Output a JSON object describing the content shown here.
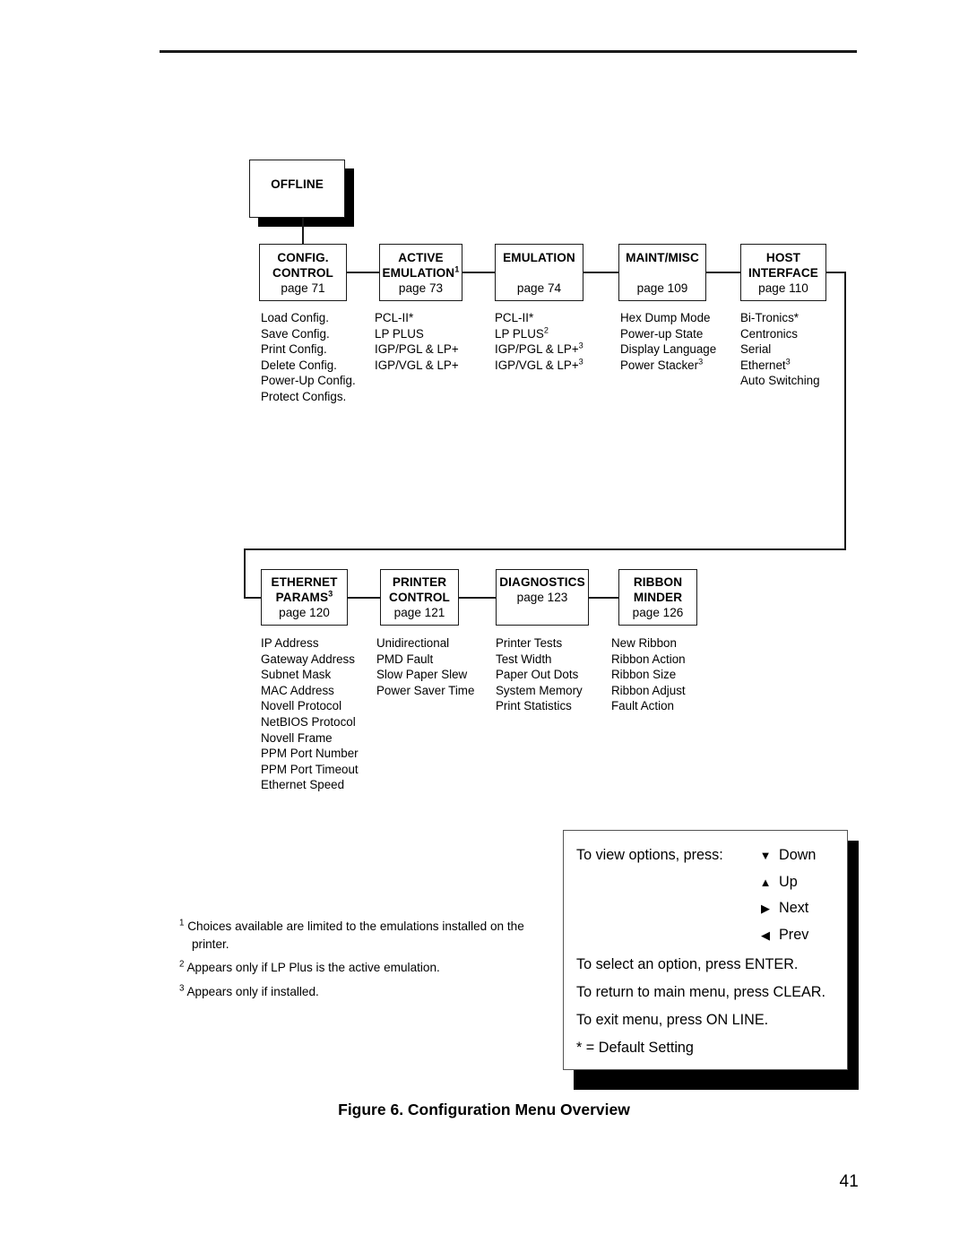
{
  "page": {
    "number": "41",
    "figure_caption": "Figure 6. Configuration Menu Overview"
  },
  "flowchart": {
    "root": {
      "title": "OFFLINE"
    },
    "row1": [
      {
        "name": "config-control",
        "title_line1": "CONFIG.",
        "title_line2": "CONTROL",
        "page": "page 71",
        "options": [
          "Load Config.",
          "Save Config.",
          "Print Config.",
          "Delete Config.",
          "Power-Up Config.",
          "Protect Configs."
        ]
      },
      {
        "name": "active-emulation",
        "title_line1": "ACTIVE",
        "title_line2": "EMULATION",
        "title_line2_sup": "1",
        "page": "page 73",
        "options": [
          "PCL-II*",
          "LP PLUS",
          "IGP/PGL & LP+",
          "IGP/VGL & LP+"
        ]
      },
      {
        "name": "emulation",
        "title_line1": "EMULATION",
        "page": "page 74",
        "options": [
          "PCL-II*",
          "LP PLUS",
          "IGP/PGL & LP+",
          "IGP/VGL & LP+"
        ],
        "option_sups": [
          "",
          "2",
          "3",
          "3"
        ]
      },
      {
        "name": "maint-misc",
        "title_line1": "MAINT/MISC",
        "page": "page 109",
        "options": [
          "Hex Dump Mode",
          "Power-up State",
          "Display Language",
          "Power Stacker"
        ],
        "option_sups": [
          "",
          "",
          "",
          "3"
        ]
      },
      {
        "name": "host-interface",
        "title_line1": "HOST",
        "title_line2": "INTERFACE",
        "page": "page 110",
        "options": [
          "Bi-Tronics*",
          "Centronics",
          "Serial",
          "Ethernet",
          "Auto Switching"
        ],
        "option_sups": [
          "",
          "",
          "",
          "3",
          ""
        ]
      }
    ],
    "row2": [
      {
        "name": "ethernet-params",
        "title_line1": "ETHERNET",
        "title_line2": "PARAMS",
        "title_line2_sup": "3",
        "page": "page 120",
        "options": [
          "IP Address",
          "Gateway Address",
          "Subnet Mask",
          "MAC Address",
          "Novell Protocol",
          "NetBIOS Protocol",
          "Novell Frame",
          "PPM Port Number",
          "PPM Port Timeout",
          "Ethernet Speed"
        ]
      },
      {
        "name": "printer-control",
        "title_line1": "PRINTER",
        "title_line2": "CONTROL",
        "page": "page 121",
        "options": [
          "Unidirectional",
          "PMD Fault",
          "Slow Paper Slew",
          "Power Saver Time"
        ]
      },
      {
        "name": "diagnostics",
        "title_line1": "DIAGNOSTICS",
        "page": "page 123",
        "options": [
          "Printer Tests",
          "Test Width",
          "Paper Out Dots",
          "System Memory",
          "Print Statistics"
        ]
      },
      {
        "name": "ribbon-minder",
        "title_line1": "RIBBON",
        "title_line2": "MINDER",
        "page": "page 126",
        "options": [
          "New Ribbon",
          "Ribbon Action",
          "Ribbon Size",
          "Ribbon Adjust",
          "Fault Action"
        ]
      }
    ]
  },
  "footnotes": [
    {
      "mark": "1",
      "text": "Choices available are limited to the emulations installed on the printer."
    },
    {
      "mark": "2",
      "text": "Appears only if LP Plus is the active emulation."
    },
    {
      "mark": "3",
      "text": "Appears only if installed."
    }
  ],
  "instructions": {
    "view_options_lead": "To view options, press:",
    "keys": [
      {
        "arrow": "▼",
        "label": "Down",
        "icon": "arrow-down-icon"
      },
      {
        "arrow": "▲",
        "label": "Up",
        "icon": "arrow-up-icon"
      },
      {
        "arrow": "▶",
        "label": "Next",
        "icon": "arrow-right-icon"
      },
      {
        "arrow": "◀",
        "label": "Prev",
        "icon": "arrow-left-icon"
      }
    ],
    "select_line": "To select an option, press ENTER.",
    "return_line": "To return to main menu, press CLEAR.",
    "exit_line": "To exit menu, press ON LINE.",
    "default_line": "* = Default Setting"
  }
}
